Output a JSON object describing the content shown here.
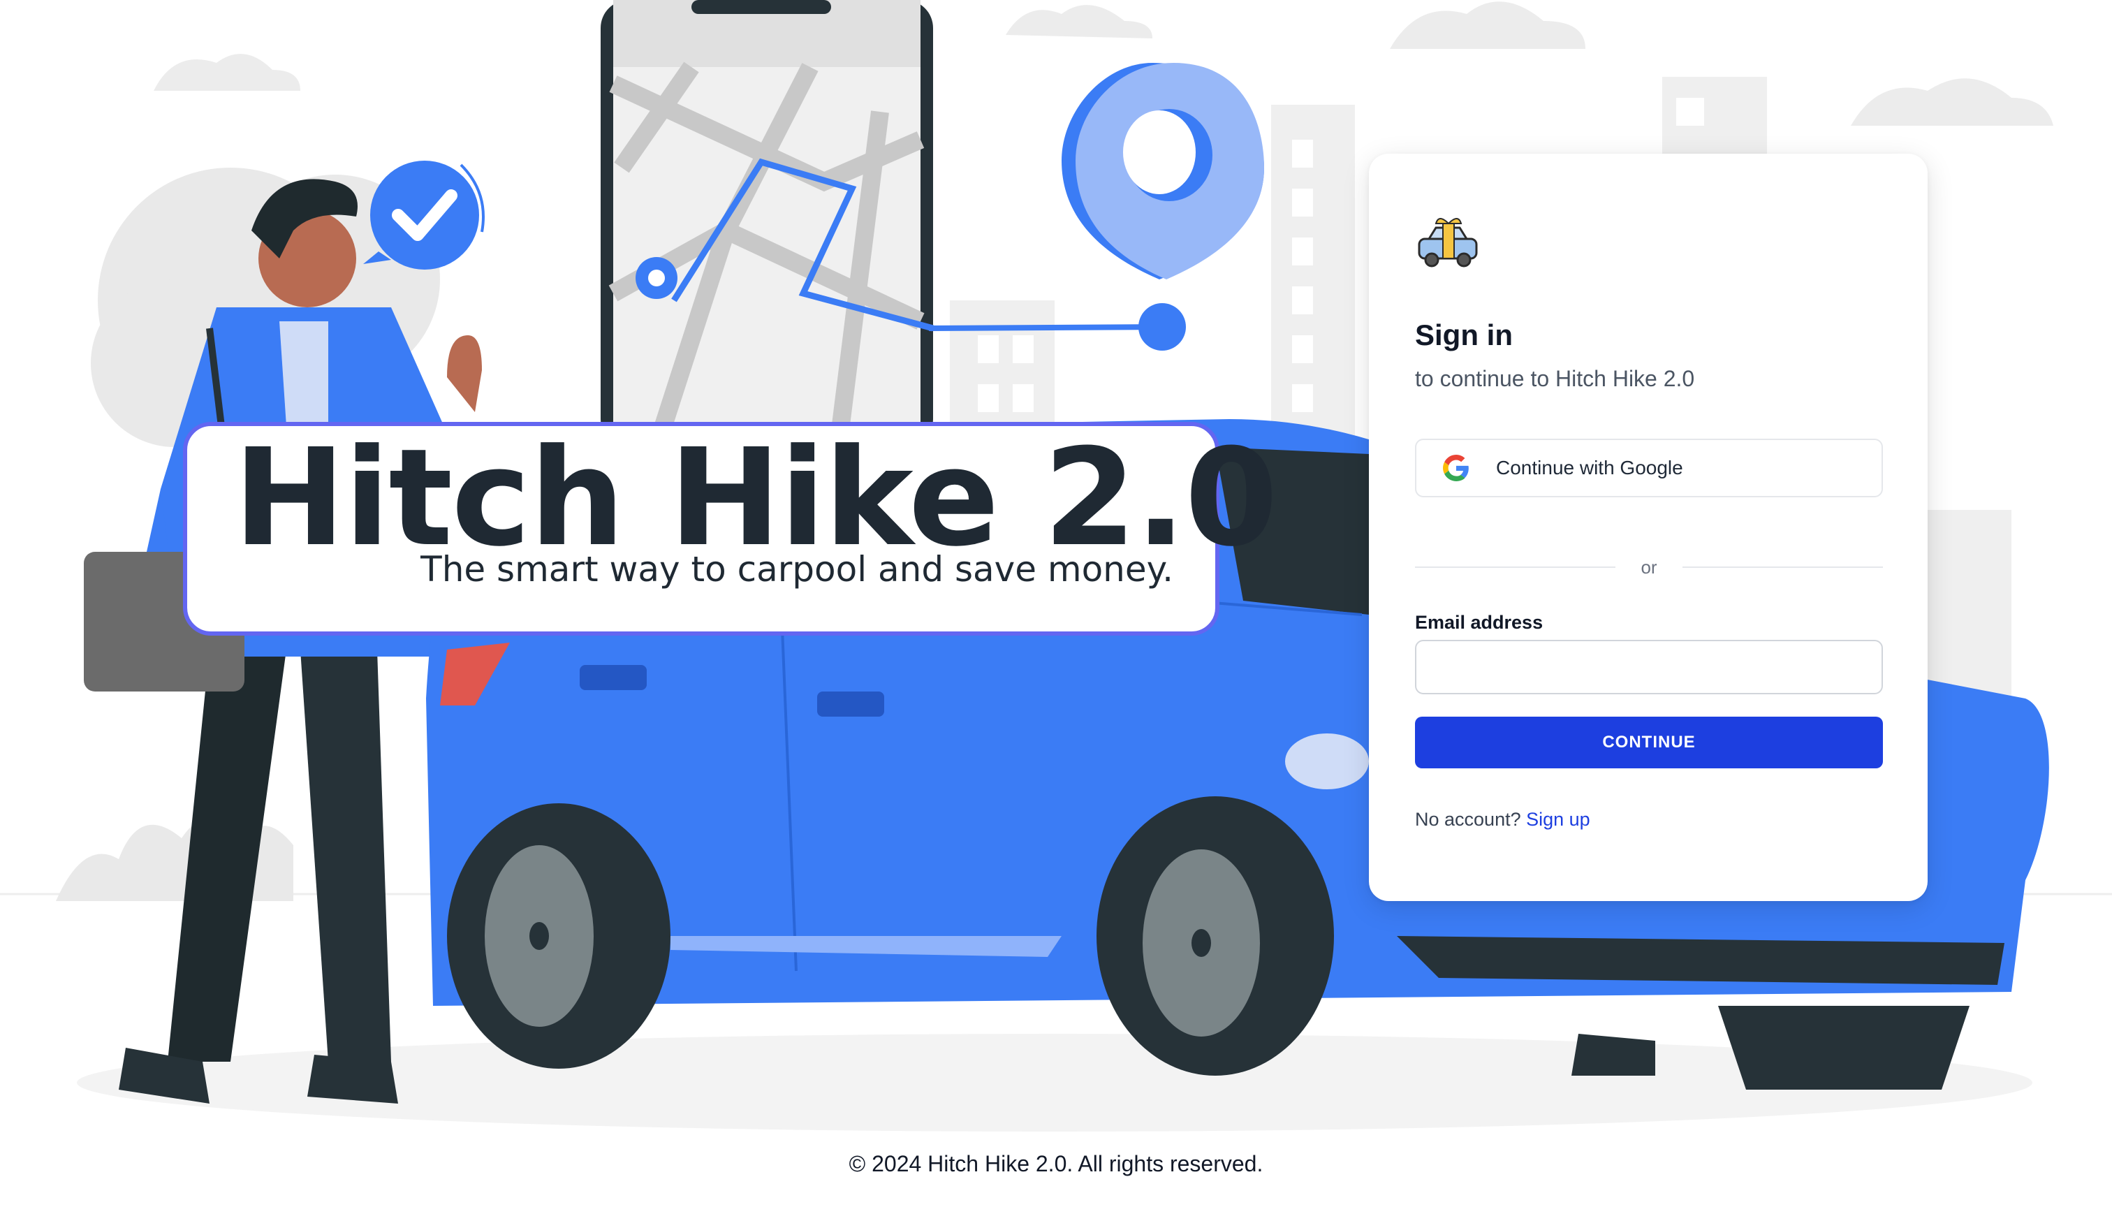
{
  "hero": {
    "title": "Hitch Hike 2.0",
    "tagline": "The smart way to carpool and save money."
  },
  "signin": {
    "title": "Sign in",
    "subtitle": "to continue to Hitch Hike 2.0",
    "google_label": "Continue with Google",
    "divider_text": "or",
    "email_label": "Email address",
    "email_value": "",
    "email_placeholder": "",
    "continue_label": "CONTINUE",
    "no_account_text": "No account?",
    "signup_label": "Sign up"
  },
  "footer": {
    "text": "© 2024 Hitch Hike 2.0. All rights reserved."
  },
  "colors": {
    "brand_blue": "#3b7cf5",
    "button_blue": "#1d3fe0",
    "hero_border": "#6366f1",
    "dark_navy": "#1f2933"
  },
  "icons": [
    "car-logo-icon",
    "google-icon",
    "checkmark-bubble-icon",
    "location-pin-icon"
  ]
}
